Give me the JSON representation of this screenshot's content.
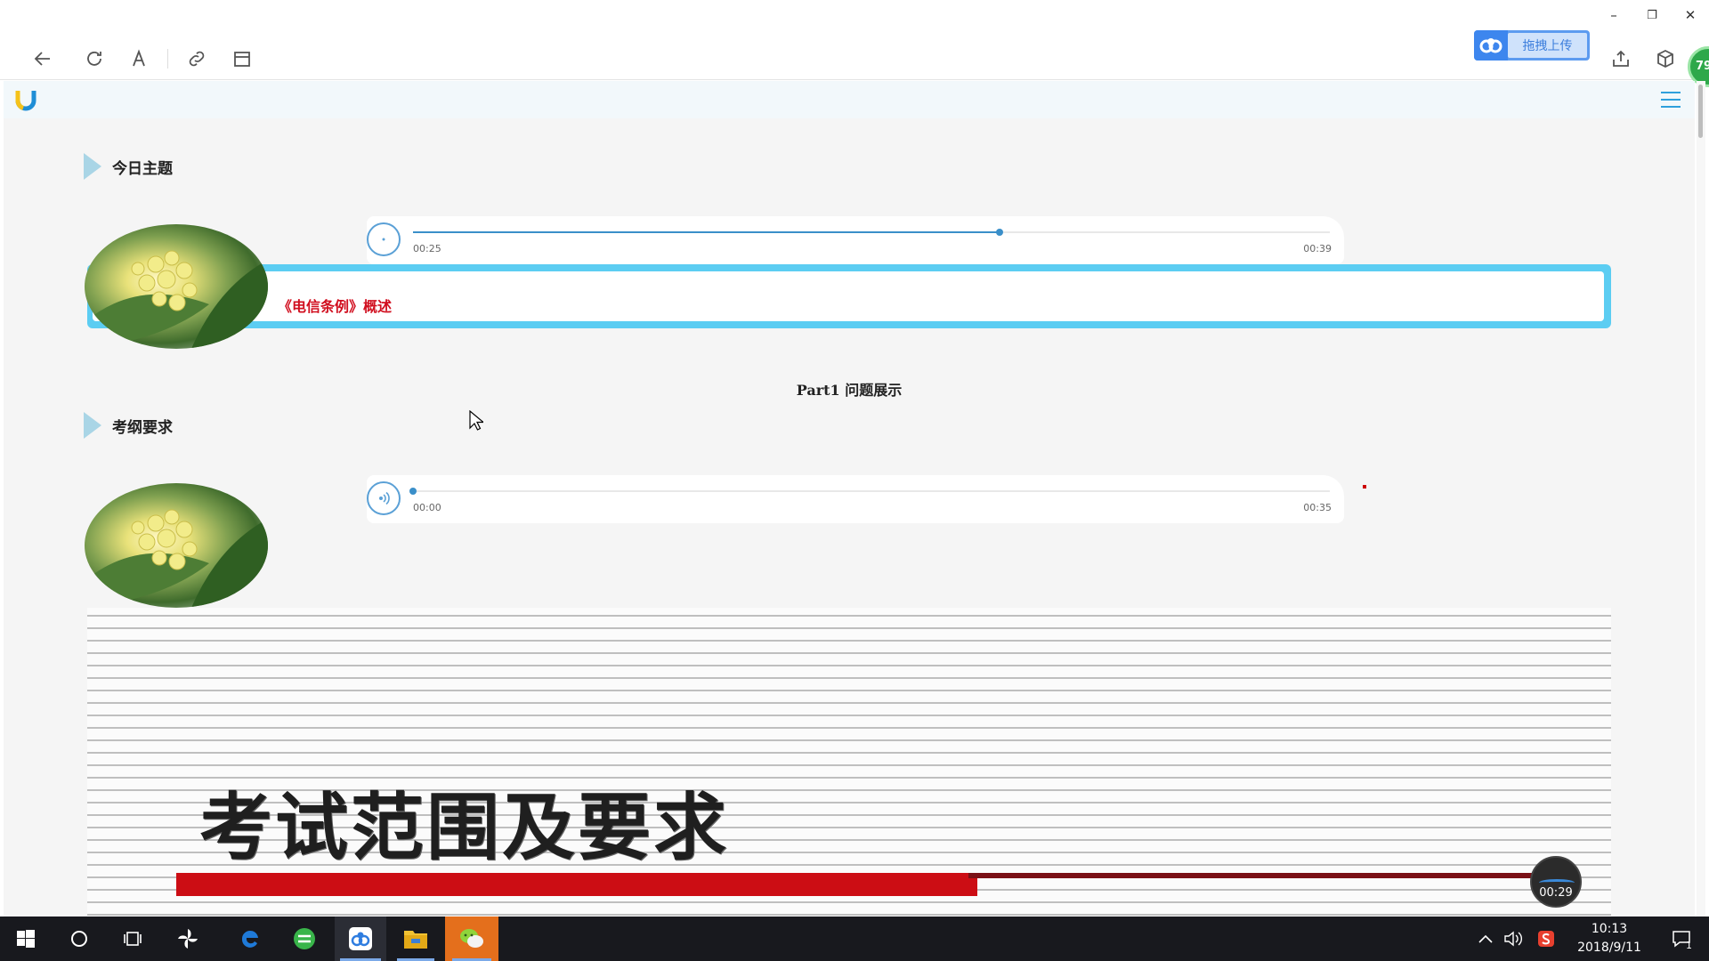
{
  "window": {
    "minimize_glyph": "–",
    "restore_glyph": "❐",
    "close_glyph": "✕"
  },
  "toolbar": {
    "icons": [
      "back-arrow-icon",
      "refresh-icon",
      "font-icon",
      "link-icon",
      "window-icon"
    ],
    "upload_label": "拖拽上传",
    "share_icon": "share-icon",
    "box_icon": "cube-icon",
    "badge_value": "79"
  },
  "page": {
    "brand_logo": "U",
    "menu_icon": "hamburger-menu-icon",
    "sections": [
      {
        "title": "今日主题",
        "audio": {
          "current_time": "00:25",
          "total_time": "00:39",
          "progress": 0.64
        },
        "topic_text": "《电信条例》概述"
      },
      {
        "title": "考纲要求",
        "audio": {
          "current_time": "00:00",
          "total_time": "00:35",
          "progress": 0.0
        }
      }
    ],
    "part_title": "Part1 问题展示",
    "slide_title": "考试范围及要求",
    "floating_timer": "00:29"
  },
  "taskbar": {
    "apps": [
      "start-icon",
      "cortana-icon",
      "task-view-icon",
      "pinwheel-app-icon",
      "edge-icon",
      "green-browser-icon",
      "baidu-netdisk-icon",
      "file-explorer-icon",
      "wechat-icon"
    ],
    "clock_time": "10:13",
    "clock_date": "2018/9/11",
    "notification_count": "1"
  },
  "colors": {
    "accent_blue": "#5ccdf2",
    "progress_blue": "#3a8fc9",
    "topic_red": "#d10f1f",
    "slide_red": "#cc0d14",
    "taskbar_bg": "#18191e"
  }
}
